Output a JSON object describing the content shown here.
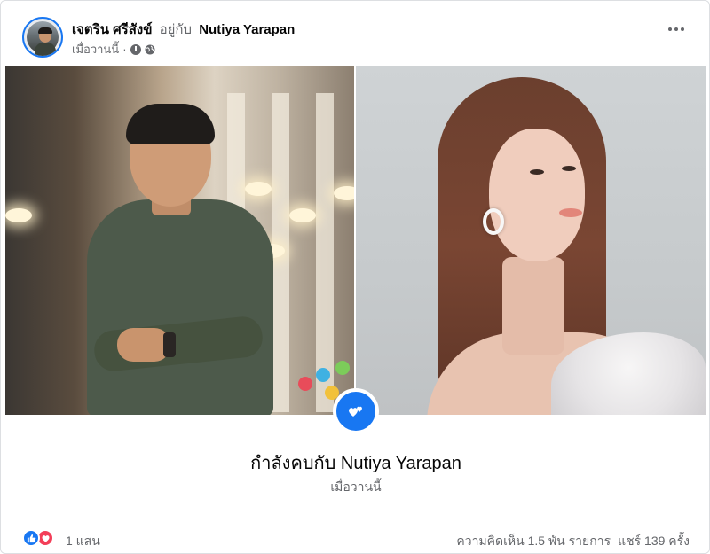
{
  "post": {
    "author": "เจตริน ศรีสังข์",
    "with_text": "อยู่กับ",
    "tagged": "Nutiya Yarapan",
    "time": "เมื่อวานนี้",
    "privacy_icon": "globe-icon"
  },
  "relationship": {
    "status_prefix": "กำลังคบกับ",
    "partner": "Nutiya Yarapan",
    "time": "เมื่อวานนี้",
    "icon": "hearts-icon",
    "accent": "#1877f2"
  },
  "reactions": {
    "icons": [
      "like-icon",
      "love-icon"
    ],
    "count": "1 แสน",
    "like_color": "#1877f2",
    "love_color": "#f33e58"
  },
  "stats": {
    "comments": "ความคิดเห็น 1.5 พัน รายการ",
    "shares": "แชร์ 139 ครั้ง"
  }
}
